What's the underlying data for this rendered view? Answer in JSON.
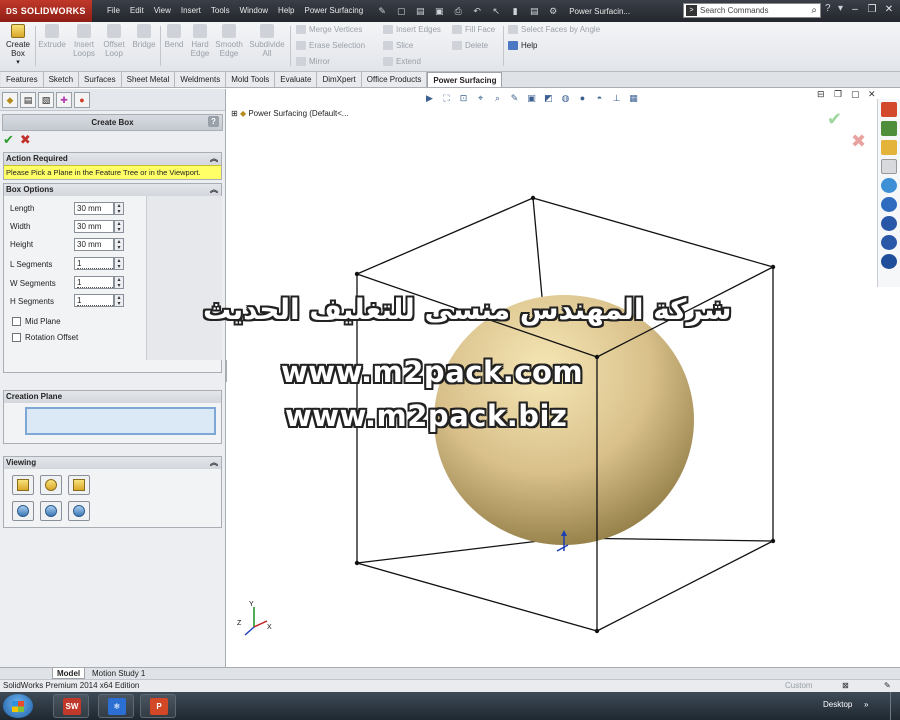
{
  "app": {
    "logo_text": "SOLIDWORKS",
    "logo_prefix": "DS",
    "document_title": "Power Surfacin...",
    "search_placeholder": "Search Commands"
  },
  "menus": [
    "File",
    "Edit",
    "View",
    "Insert",
    "Tools",
    "Window",
    "Help",
    "Power Surfacing"
  ],
  "ribbon": {
    "large_buttons": [
      {
        "label": "Create Box",
        "active": true
      },
      {
        "label": "Extrude",
        "active": false
      },
      {
        "label": "Insert Loops",
        "active": false
      },
      {
        "label": "Offset Loop",
        "active": false
      },
      {
        "label": "Bridge",
        "active": false
      },
      {
        "label": "Bend",
        "active": false
      },
      {
        "label": "Hard Edge",
        "active": false
      },
      {
        "label": "Smooth Edge",
        "active": false
      },
      {
        "label": "Subdivide All",
        "active": false
      }
    ],
    "small_buttons": [
      {
        "label": "Merge Vertices",
        "active": false
      },
      {
        "label": "Erase Selection",
        "active": false
      },
      {
        "label": "Mirror",
        "active": false
      },
      {
        "label": "Insert Edges",
        "active": false
      },
      {
        "label": "Slice",
        "active": false
      },
      {
        "label": "Extend",
        "active": false
      },
      {
        "label": "Fill Face",
        "active": false
      },
      {
        "label": "Delete",
        "active": false
      },
      {
        "label": "Select Faces by Angle",
        "active": false
      },
      {
        "label": "Help",
        "active": true
      }
    ]
  },
  "tabs": [
    {
      "label": "Features",
      "active": false
    },
    {
      "label": "Sketch",
      "active": false
    },
    {
      "label": "Surfaces",
      "active": false
    },
    {
      "label": "Sheet Metal",
      "active": false
    },
    {
      "label": "Weldments",
      "active": false
    },
    {
      "label": "Mold Tools",
      "active": false
    },
    {
      "label": "Evaluate",
      "active": false
    },
    {
      "label": "DimXpert",
      "active": false
    },
    {
      "label": "Office Products",
      "active": false
    },
    {
      "label": "Power Surfacing",
      "active": true
    }
  ],
  "property_manager": {
    "title": "Create Box",
    "help_glyph": "?",
    "action_required": {
      "header": "Action Required",
      "message": "Please Pick a Plane in the Feature Tree or in the Viewport."
    },
    "box_options": {
      "header": "Box Options",
      "fields": [
        {
          "label": "Length",
          "value": "30 mm"
        },
        {
          "label": "Width",
          "value": "30 mm"
        },
        {
          "label": "Height",
          "value": "30 mm"
        },
        {
          "label": "L Segments",
          "value": "1"
        },
        {
          "label": "W Segments",
          "value": "1"
        },
        {
          "label": "H Segments",
          "value": "1"
        }
      ],
      "checkboxes": [
        {
          "label": "Mid Plane",
          "checked": false
        },
        {
          "label": "Rotation Offset",
          "checked": false
        }
      ]
    },
    "creation_plane": {
      "header": "Creation Plane",
      "value": ""
    },
    "viewing": {
      "header": "Viewing"
    }
  },
  "viewport": {
    "tree_node": "Power Surfacing  (Default<...",
    "watermark_arabic": "شركة المهندس منسى للتغليف الحديث",
    "watermark_url1": "www.m2pack.com",
    "watermark_url2": "www.m2pack.biz",
    "colors": {
      "sphere_light": "#f5e7b6",
      "sphere_dark": "#8f7a43",
      "ok": "#9fd79f",
      "cancel": "#e8a3a0"
    }
  },
  "model_tabs": [
    {
      "label": "Model",
      "active": true
    },
    {
      "label": "Motion Study 1",
      "active": false
    }
  ],
  "status": {
    "text": "SolidWorks Premium 2014 x64 Edition",
    "custom": "Custom"
  },
  "taskbar": {
    "desktop_label": "Desktop",
    "apps": [
      {
        "name": "solidworks-taskbar-icon",
        "glyph": "SW",
        "color": "#c0392b"
      },
      {
        "name": "snowflake-app-taskbar-icon",
        "glyph": "❄",
        "color": "#2a6fd1"
      },
      {
        "name": "powerpoint-taskbar-icon",
        "glyph": "P",
        "color": "#d24726"
      }
    ]
  }
}
